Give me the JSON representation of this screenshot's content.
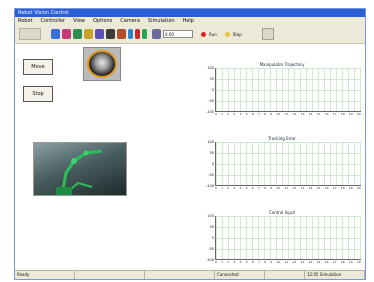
{
  "window": {
    "title": "Robot Vision Control"
  },
  "menubar": [
    "Robot",
    "Controller",
    "View",
    "Options",
    "Camera",
    "Simulation",
    "Help"
  ],
  "toolbar": {
    "buttons": [
      {
        "icon": "move-icon",
        "color": "#3a6fd8"
      },
      {
        "icon": "gripper-icon",
        "color": "#c23a7a"
      },
      {
        "icon": "joint-icon",
        "color": "#2f8f4f"
      },
      {
        "icon": "camera-icon",
        "color": "#c9a12a"
      },
      {
        "icon": "rotate-icon",
        "color": "#5a4fb6"
      },
      {
        "icon": "arm-icon",
        "color": "#3a3a3a"
      },
      {
        "icon": "tool-icon",
        "color": "#b2502e"
      },
      {
        "icon": "axis-x-icon",
        "color": "#2a86c9"
      },
      {
        "icon": "axis-y-icon",
        "color": "#c42b2b"
      },
      {
        "icon": "axis-z-icon",
        "color": "#2aa34d"
      }
    ],
    "input_value": "0.00",
    "indicator_1": {
      "label": "Run",
      "color": "#dd2222"
    },
    "indicator_2": {
      "label": "Stop",
      "color": "#e8c43a"
    }
  },
  "buttons": {
    "start": "Move",
    "stop": "Stop"
  },
  "plots": [
    {
      "title": "Manipulator Trajectory",
      "yticks": [
        "100",
        "50",
        "0",
        "-50",
        "-100"
      ]
    },
    {
      "title": "Tracking Error",
      "yticks": [
        "100",
        "50",
        "0",
        "-50",
        "-100"
      ]
    },
    {
      "title": "Control Input",
      "yticks": [
        "100",
        "50",
        "0",
        "-50",
        "-100"
      ]
    }
  ],
  "xticks": [
    "0",
    "1",
    "2",
    "3",
    "4",
    "5",
    "6",
    "7",
    "8",
    "9",
    "10",
    "11",
    "12",
    "13",
    "14",
    "15",
    "16",
    "17",
    "18",
    "19",
    "20"
  ],
  "statusbar": [
    "Ready",
    "",
    "",
    "Connected",
    "",
    "12:05 Simulation"
  ]
}
